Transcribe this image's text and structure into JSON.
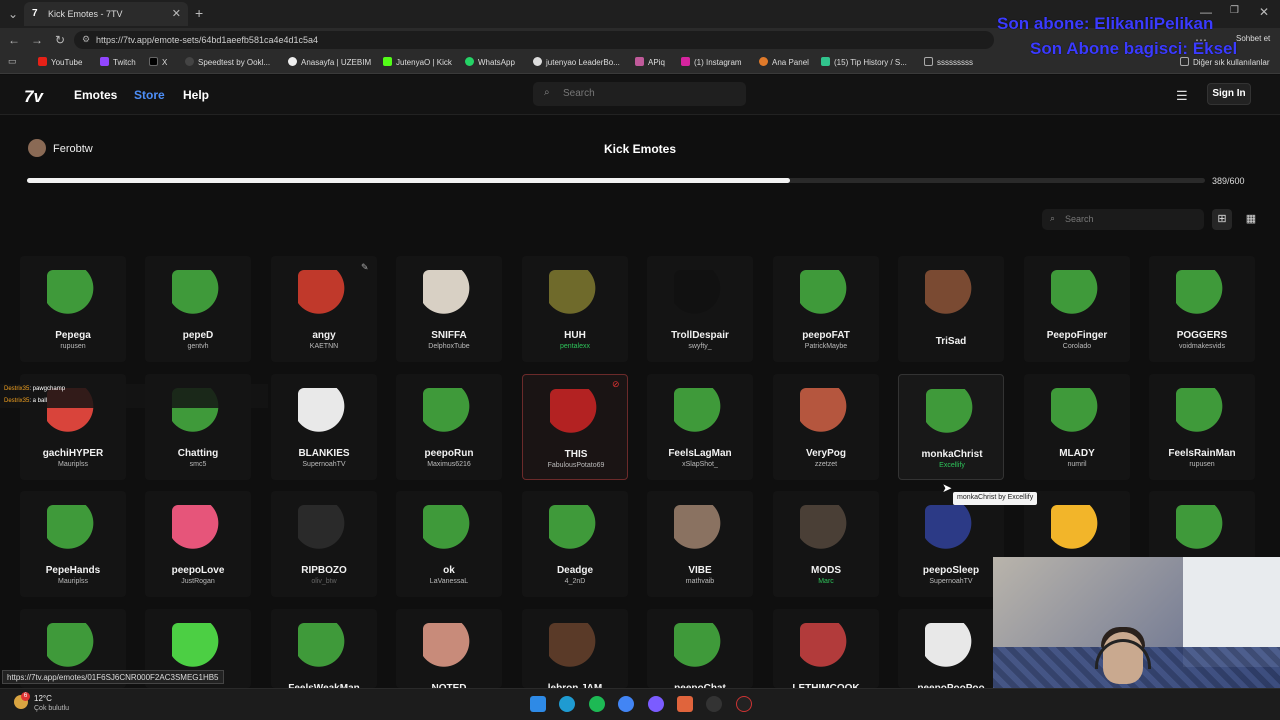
{
  "browser": {
    "tab_title": "Kick Emotes - 7TV",
    "url": "https://7tv.app/emote-sets/64bd1aeefb581ca4e4d1c5a4",
    "bookmarks": [
      "YouTube",
      "Twitch",
      "X",
      "Speedtest by Ookl...",
      "Anasayfa | UZEBIM",
      "JutenyaO | Kick",
      "WhatsApp",
      "jutenyao LeaderBo...",
      "APiq",
      "(1) Instagram",
      "Ana Panel",
      "(15) Tip History / S...",
      "sssssssss",
      "Diğer sık kullanılanlar"
    ],
    "profile_label": "Sohbet et",
    "status_url": "https://7tv.app/emotes/01F6SJ6CNR000F2AC3SMEG1HB5"
  },
  "overlay": {
    "line1": "Son abone: ElikanliPelikan",
    "line2": "Son Abone bagisci: Eksel"
  },
  "site": {
    "nav": [
      "Emotes",
      "Store",
      "Help"
    ],
    "active_nav": "Store",
    "search_placeholder": "Search",
    "sign_in": "Sign In"
  },
  "emote_set": {
    "owner": "Ferobtw",
    "title": "Kick Emotes",
    "count_text": "389/600",
    "capacity_fraction": 0.648,
    "search_placeholder": "Search"
  },
  "emotes": [
    {
      "name": "Pepega",
      "author": "rupusen",
      "color": "#3f9a3a"
    },
    {
      "name": "pepeD",
      "author": "gentvh",
      "color": "#3f9a3a"
    },
    {
      "name": "angy",
      "author": "KAETNN",
      "color": "#c0392b"
    },
    {
      "name": "SNIFFA",
      "author": "DelphoxTube",
      "color": "#d8d0c4"
    },
    {
      "name": "HUH",
      "author": "pentalexx",
      "author_style": "green",
      "color": "#6f6a2b"
    },
    {
      "name": "TrollDespair",
      "author": "swyfty_",
      "color": "#111111"
    },
    {
      "name": "peepoFAT",
      "author": "PatrickMaybe",
      "color": "#3f9a3a"
    },
    {
      "name": "TriSad",
      "author": "",
      "color": "#7a4a32"
    },
    {
      "name": "PeepoFinger",
      "author": "Corolado",
      "color": "#3f9a3a"
    },
    {
      "name": "POGGERS",
      "author": "voidmakesvids",
      "color": "#3f9a3a"
    },
    {
      "name": "gachiHYPER",
      "author": "Mauriplss",
      "color": "#d9443b"
    },
    {
      "name": "Chatting",
      "author": "smc5",
      "color": "#3f9a3a"
    },
    {
      "name": "BLANKIES",
      "author": "SupernoahTV",
      "color": "#e9e9e9"
    },
    {
      "name": "peepoRun",
      "author": "Maximus6216",
      "color": "#3f9a3a"
    },
    {
      "name": "THIS",
      "author": "FabulousPotato69",
      "color": "#b32222"
    },
    {
      "name": "FeelsLagMan",
      "author": "xSlapShot_",
      "color": "#3f9a3a"
    },
    {
      "name": "VeryPog",
      "author": "zzetzet",
      "color": "#b5563e"
    },
    {
      "name": "monkaChrist",
      "author": "Excellify",
      "author_style": "green",
      "color": "#3f9a3a"
    },
    {
      "name": "MLADY",
      "author": "numril",
      "color": "#3f9a3a"
    },
    {
      "name": "FeelsRainMan",
      "author": "rupusen",
      "color": "#3f9a3a"
    },
    {
      "name": "PepeHands",
      "author": "Mauriplss",
      "color": "#3f9a3a"
    },
    {
      "name": "peepoLove",
      "author": "JustRogan",
      "color": "#e6557a"
    },
    {
      "name": "RIPBOZO",
      "author": "oliv_btw",
      "author_style": "dim",
      "color": "#2a2a2a"
    },
    {
      "name": "ok",
      "author": "LaVanessaL",
      "color": "#3f9a3a"
    },
    {
      "name": "Deadge",
      "author": "4_2nD",
      "color": "#3f9a3a"
    },
    {
      "name": "VIBE",
      "author": "mathvaib",
      "color": "#8a7261"
    },
    {
      "name": "MODS",
      "author": "Marc",
      "author_style": "green",
      "color": "#4a3f36"
    },
    {
      "name": "peepoSleep",
      "author": "SupernoahTV",
      "color": "#2c3a86"
    },
    {
      "name": "",
      "author": "",
      "color": "#f2b52a"
    },
    {
      "name": "",
      "author": "",
      "color": "#3f9a3a"
    },
    {
      "name": "",
      "author": "",
      "color": "#3f9a3a"
    },
    {
      "name": "",
      "author": "",
      "color": "#4ccf44"
    },
    {
      "name": "FeelsWeakMan",
      "author": "",
      "color": "#3f9a3a"
    },
    {
      "name": "NOTED",
      "author": "",
      "color": "#c88b7a"
    },
    {
      "name": "lebron JAM",
      "author": "",
      "color": "#5a3a28"
    },
    {
      "name": "peepoChat",
      "author": "",
      "color": "#3f9a3a"
    },
    {
      "name": "LETHIMCOOK",
      "author": "",
      "color": "#b23b3b"
    },
    {
      "name": "peepoPooPoo",
      "author": "",
      "color": "#e8e8e8"
    }
  ],
  "tooltip": "monkaChrist by Excellify",
  "chat": [
    {
      "user": "Destrix35",
      "text": ": pawgchamp"
    },
    {
      "user": "Destrix35",
      "text": ": a ball"
    }
  ],
  "taskbar": {
    "temperature": "12°C",
    "weather": "Çok bulutlu",
    "badge": "6"
  }
}
